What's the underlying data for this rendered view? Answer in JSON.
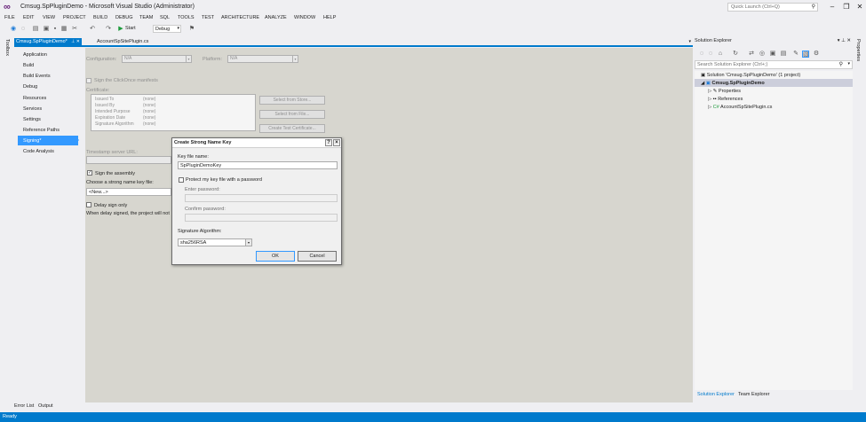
{
  "window": {
    "title": "Cmsug.SpPluginDemo - Microsoft Visual Studio (Administrator)",
    "quick_launch_placeholder": "Quick Launch (Ctrl+Q)"
  },
  "menu": [
    "FILE",
    "EDIT",
    "VIEW",
    "PROJECT",
    "BUILD",
    "DEBUG",
    "TEAM",
    "SQL",
    "TOOLS",
    "TEST",
    "ARCHITECTURE",
    "ANALYZE",
    "WINDOW",
    "HELP"
  ],
  "toolbar": {
    "start_label": "Start",
    "config_value": "Debug"
  },
  "toolbox_label": "Toolbox",
  "properties_label": "Properties",
  "tabs": {
    "active": "Cmsug.SpPluginDemo*",
    "inactive": "AccountSpSitePlugin.cs"
  },
  "project_nav": {
    "items": [
      "Application",
      "Build",
      "Build Events",
      "Debug",
      "Resources",
      "Services",
      "Settings",
      "Reference Paths",
      "Signing*",
      "Code Analysis"
    ],
    "selected": "Signing*"
  },
  "signing": {
    "configuration_label": "Configuration:",
    "configuration_value": "N/A",
    "platform_label": "Platform:",
    "platform_value": "N/A",
    "clickonce_label": "Sign the ClickOnce manifests",
    "certificate_label": "Certificate:",
    "cert_rows": [
      {
        "key": "Issued To",
        "value": "(none)"
      },
      {
        "key": "Issued By",
        "value": "(none)"
      },
      {
        "key": "Intended Purpose",
        "value": "(none)"
      },
      {
        "key": "Expiration Date",
        "value": "(none)"
      },
      {
        "key": "Signature Algorithm",
        "value": "(none)"
      }
    ],
    "select_from_store": "Select from Store...",
    "select_from_file": "Select from File...",
    "create_test_cert": "Create Test Certificate...",
    "timestamp_label": "Timestamp server URL:",
    "sign_assembly_label": "Sign the assembly",
    "choose_key_label": "Choose a strong name key file:",
    "key_file_value": "<New...>",
    "delay_sign_label": "Delay sign only",
    "delay_sign_note": "When delay signed, the project will not"
  },
  "dialog": {
    "title": "Create Strong Name Key",
    "help_btn": "?",
    "close_btn": "×",
    "key_file_label": "Key file name:",
    "key_file_value": "SpPluginDemoKey",
    "protect_label": "Protect my key file with a password",
    "enter_password_label": "Enter password:",
    "confirm_password_label": "Confirm password:",
    "sig_algorithm_label": "Signature Algorithm:",
    "sig_algorithm_value": "sha256RSA",
    "ok_label": "OK",
    "cancel_label": "Cancel"
  },
  "solution_explorer": {
    "title": "Solution Explorer",
    "search_placeholder": "Search Solution Explorer (Ctrl+;)",
    "tree": [
      {
        "label": "Solution 'Cmsug.SpPluginDemo' (1 project)"
      },
      {
        "label": "Cmsug.SpPluginDemo"
      },
      {
        "label": "Properties"
      },
      {
        "label": "References"
      },
      {
        "label": "AccountSpSitePlugin.cs"
      }
    ],
    "tabs": [
      "Solution Explorer",
      "Team Explorer"
    ]
  },
  "bottom_tabs": [
    "Error List",
    "Output"
  ],
  "status": "Ready",
  "colors": {
    "accent": "#007acc",
    "selection": "#3399ff",
    "vs_purple": "#68217a"
  }
}
